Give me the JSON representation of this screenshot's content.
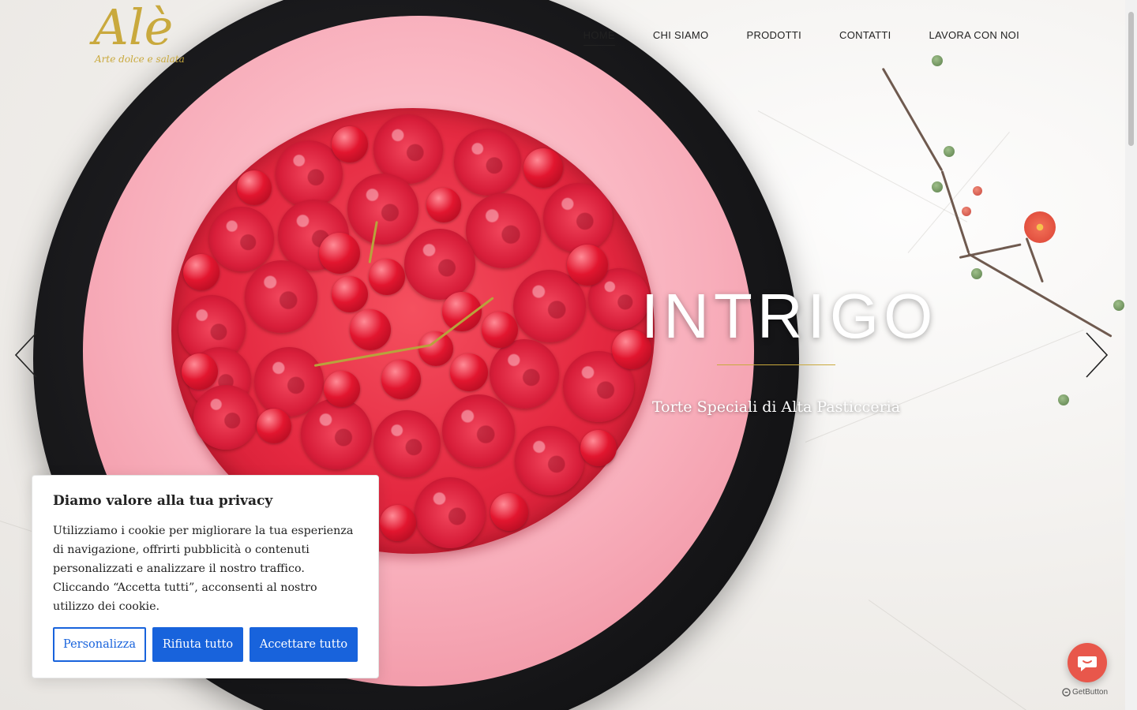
{
  "brand": {
    "logo_text": "Alè",
    "logo_subtitle": "Arte dolce e salata",
    "accent_color": "#c9a93d"
  },
  "nav": {
    "items": [
      {
        "label": "HOME",
        "active": true
      },
      {
        "label": "CHI SIAMO",
        "active": false
      },
      {
        "label": "PRODOTTI",
        "active": false
      },
      {
        "label": "CONTATTI",
        "active": false
      },
      {
        "label": "LAVORA CON NOI",
        "active": false
      }
    ]
  },
  "slider": {
    "title": "INTRIGO",
    "subtitle": "Torte Speciali di Alta Pasticceria",
    "prev_icon": "chevron-left-icon",
    "next_icon": "chevron-right-icon"
  },
  "cookie_banner": {
    "title": "Diamo valore alla tua privacy",
    "text": "Utilizziamo i cookie per migliorare la tua esperienza di navigazione, offrirti pubblicità o contenuti personalizzati e analizzare il nostro traffico. Cliccando “Accetta tutti”, acconsenti al nostro utilizzo dei cookie.",
    "customize_label": "Personalizza",
    "reject_label": "Rifiuta tutto",
    "accept_label": "Accettare tutto",
    "button_color": "#1863dc"
  },
  "chat_widget": {
    "icon": "chat-bubble-icon",
    "brand_label": "GetButton",
    "color": "#e8574b"
  }
}
